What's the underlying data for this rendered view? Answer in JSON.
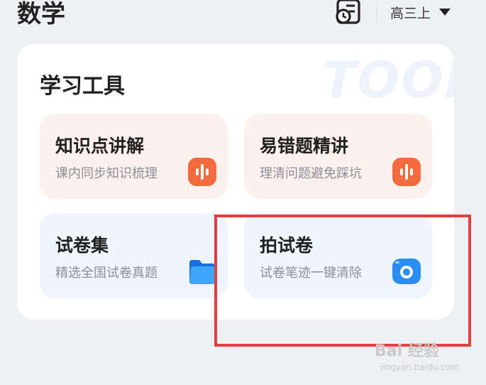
{
  "header": {
    "title": "数学",
    "history_icon": "clock-book-icon",
    "grade": "高三上"
  },
  "tools_section": {
    "title": "学习工具",
    "watermark": "TOOL",
    "items": [
      {
        "title": "知识点讲解",
        "subtitle": "课内同步知识梳理",
        "icon": "audio-wave-icon",
        "color": "#f36a3e"
      },
      {
        "title": "易错题精讲",
        "subtitle": "理清问题避免踩坑",
        "icon": "audio-wave-icon",
        "color": "#f36a3e"
      },
      {
        "title": "试卷集",
        "subtitle": "精选全国试卷真题",
        "icon": "folder-icon",
        "color": "#2a8df5"
      },
      {
        "title": "拍试卷",
        "subtitle": "试卷笔迹一键清除",
        "icon": "camera-icon",
        "color": "#2a8df5"
      }
    ]
  },
  "annotation_color": "#e2403e",
  "watermark": {
    "brand": "Bai 经验",
    "url": "jingyan.baidu.com"
  }
}
